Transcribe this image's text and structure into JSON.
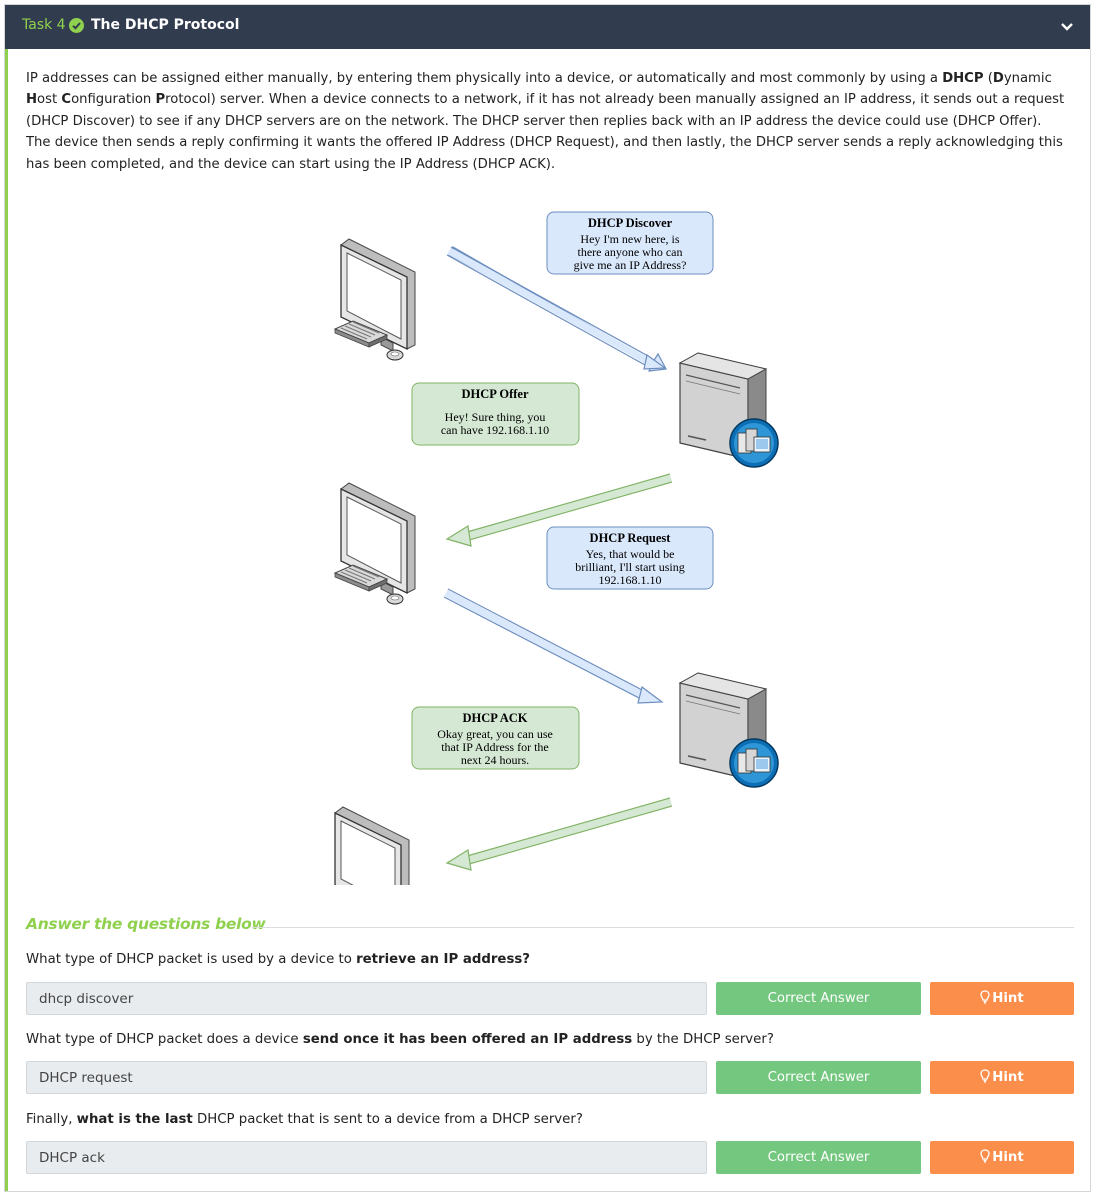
{
  "header": {
    "task_label": "Task 4",
    "title": "The DHCP Protocol"
  },
  "intro": {
    "p1": "IP addresses can be assigned either manually, by entering them physically into a device, or automatically and most commonly by using a ",
    "dhcp_bold": "DHCP",
    "p2": " (",
    "d": "D",
    "ynamic": "ynamic ",
    "h": "H",
    "ost": "ost",
    "c": "C",
    "onfiguration": "onfiguration ",
    "p": "P",
    "rotocol": "rotocol",
    "p3": ") server. When a device connects to a network, if it has not already been manually assigned an IP address, it sends out a request (DHCP Discover) to see if any DHCP servers are on the network. The DHCP server then replies back with an IP address the device could use (DHCP Offer). The device then sends a reply confirming it wants the offered IP Address (DHCP Request), and then lastly, the DHCP server sends a reply acknowledging this has been completed, and the device can start using the IP Address (DHCP ACK)."
  },
  "diagram": {
    "discover": {
      "title": "DHCP Discover",
      "lines": [
        "Hey I'm new here, is",
        "there anyone who can",
        "give me an IP Address?"
      ]
    },
    "offer": {
      "title": "DHCP Offer",
      "lines": [
        "Hey! Sure thing, you",
        "can have 192.168.1.10"
      ]
    },
    "request": {
      "title": "DHCP Request",
      "lines": [
        "Yes, that would be",
        "brilliant, I'll start using",
        "192.168.1.10"
      ]
    },
    "ack": {
      "title": "DHCP ACK",
      "lines": [
        "Okay great, you can use",
        "that IP Address for the",
        "next 24 hours."
      ]
    },
    "colors": {
      "blue_fill": "#dae8fc",
      "blue_stroke": "#6c8ebf",
      "green_fill": "#d5e8d4",
      "green_stroke": "#82b366"
    }
  },
  "answers_heading": "Answer the questions below",
  "questions": [
    {
      "pre": "What type of DHCP packet is used by a device to ",
      "bold": "retrieve an IP address?",
      "post": "",
      "answer": "dhcp discover"
    },
    {
      "pre": "What type of DHCP packet does a device ",
      "bold": "send once it has been offered an IP address",
      "post": " by the DHCP server?",
      "answer": "DHCP request"
    },
    {
      "pre": "Finally, ",
      "bold": "what is the last",
      "post": " DHCP packet that is sent to a device from a DHCP server?",
      "answer": "DHCP ack"
    }
  ],
  "buttons": {
    "correct_label": "Correct Answer",
    "hint_label": "Hint"
  },
  "colors": {
    "header_bg": "#323c4f",
    "accent_green": "#8fd14f",
    "correct_green": "#74c77f",
    "hint_orange": "#fb8e4a"
  }
}
